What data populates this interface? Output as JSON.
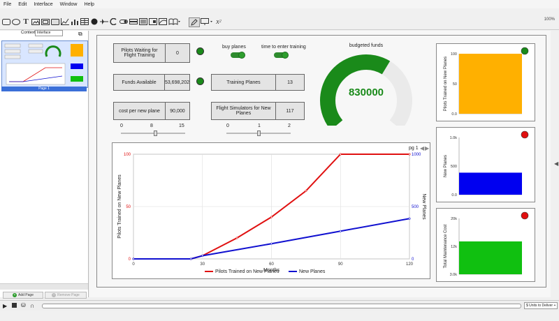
{
  "menu": [
    "File",
    "Edit",
    "Interface",
    "Window",
    "Help"
  ],
  "toolbar": {
    "zoom": "100%"
  },
  "left_panel": {
    "context_label": "Context",
    "context_value": "Interface",
    "page_caption": "Page 1",
    "add_page": "Add Page",
    "remove_page": "Remove Page"
  },
  "controls": {
    "pilots_waiting": {
      "label": "Pilots Waiting for Flight Training",
      "value": "0"
    },
    "funds_available": {
      "label": "Funds Available",
      "value": "53,698,202"
    },
    "cost_per_plane": {
      "label": "cost per new plane",
      "value": "90,000"
    },
    "training_planes": {
      "label": "Training Planes",
      "value": "13"
    },
    "flight_simulators": {
      "label": "Flight Simulators for New Planes",
      "value": "117"
    },
    "buy_planes_label": "buy planes",
    "time_to_train_label": "time to enter training",
    "slider1": {
      "min": "0",
      "value": "8",
      "max": "15",
      "frac": 0.53
    },
    "slider2": {
      "min": "0",
      "value": "1",
      "max": "2",
      "frac": 0.5
    },
    "lamp_colors": {
      "green": "#1a8a1a",
      "red": "#e01010"
    }
  },
  "gauge": {
    "title": "budgeted funds",
    "value": "830000",
    "fraction": 0.62,
    "color": "#1a8a1a"
  },
  "chart_data": [
    {
      "type": "line",
      "xlabel": "Months",
      "ylabel": "Pilots Trained on New Planes",
      "y2label": "New Planes",
      "page_indicator": "pg 1",
      "x_ticks": [
        "0",
        "30",
        "60",
        "90",
        "120"
      ],
      "xlim": [
        0,
        120
      ],
      "y_ticks": [
        "0",
        "50",
        "100"
      ],
      "ylim": [
        0,
        100
      ],
      "y2_ticks": [
        "0",
        "500",
        "1000"
      ],
      "y2lim": [
        0,
        1000
      ],
      "series": [
        {
          "name": "Pilots Trained on New Planes",
          "color": "#e01010",
          "axis": "left",
          "x": [
            0,
            25,
            30,
            45,
            60,
            75,
            90,
            120
          ],
          "y": [
            0,
            0,
            3,
            20,
            40,
            65,
            100,
            100
          ]
        },
        {
          "name": "New Planes",
          "color": "#1010d0",
          "axis": "right",
          "x": [
            0,
            25,
            30,
            60,
            90,
            120
          ],
          "y": [
            0,
            0,
            30,
            145,
            265,
            385
          ]
        }
      ]
    },
    {
      "type": "bar",
      "ylabel": "Pilots Trained on New Planes",
      "y_ticks": [
        "0.0",
        "50",
        "100"
      ],
      "ylim": [
        0,
        100
      ],
      "values": [
        100
      ],
      "color": "#ffb000",
      "lamp": "green"
    },
    {
      "type": "bar",
      "ylabel": "New Planes",
      "y_ticks": [
        "0.0",
        "500",
        "1.0k"
      ],
      "ylim": [
        0,
        1000
      ],
      "values": [
        385
      ],
      "color": "#0000f0",
      "lamp": "red"
    },
    {
      "type": "bar",
      "ylabel": "Total Maintenance Cost",
      "y_ticks": [
        "3.0k",
        "12k",
        "20k"
      ],
      "ylim": [
        3000,
        20000
      ],
      "values": [
        13000
      ],
      "color": "#10c010",
      "lamp": "red"
    }
  ],
  "status": {
    "units_text": "$ Units to Deliver + ..."
  }
}
